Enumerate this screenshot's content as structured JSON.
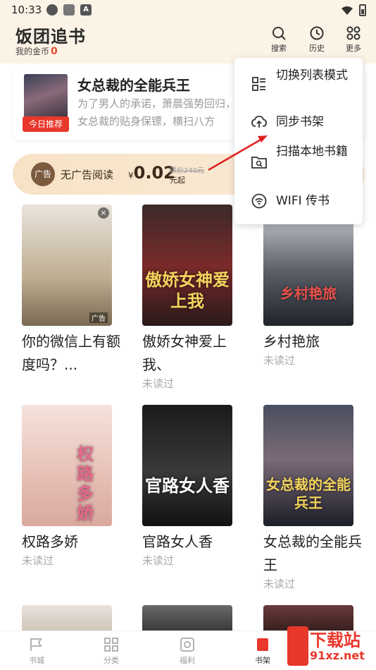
{
  "status_bar": {
    "time": "10:33"
  },
  "header": {
    "app_title": "饭团追书",
    "coins_label": "我的金币",
    "coins_value": "0",
    "actions": [
      {
        "label": "搜索",
        "icon": "search-icon"
      },
      {
        "label": "历史",
        "icon": "history-icon"
      },
      {
        "label": "更多",
        "icon": "more-icon"
      }
    ]
  },
  "banner": {
    "title": "女总裁的全能兵王",
    "description": "为了男人的承诺，萧晨强势回归，成为女总裁的贴身保镖，横扫八方",
    "tag": "今日推荐"
  },
  "ad_bar": {
    "icon_text": "广告",
    "label": "无广告阅读",
    "currency": "¥",
    "price": "0.02",
    "original_price": "原价240元",
    "unit": "元起"
  },
  "menu": {
    "items": [
      {
        "label": "切换列表模式",
        "icon": "list-mode-icon"
      },
      {
        "label": "同步书架",
        "icon": "cloud-sync-icon"
      },
      {
        "label": "扫描本地书籍",
        "icon": "scan-folder-icon"
      },
      {
        "label": "WIFI 传书",
        "icon": "wifi-icon"
      }
    ]
  },
  "books": [
    {
      "title": "你的微信上有额度吗？...",
      "status": "",
      "cover_text": "",
      "ad": "广告"
    },
    {
      "title": "傲娇女神爱上我、",
      "status": "未读过",
      "cover_text": "傲娇女神爱上我"
    },
    {
      "title": "乡村艳旅",
      "status": "未读过",
      "cover_text": "乡村艳旅"
    },
    {
      "title": "权路多娇",
      "status": "未读过",
      "cover_text": "权路多娇"
    },
    {
      "title": "官路女人香",
      "status": "未读过",
      "cover_text": "官路女人香"
    },
    {
      "title": "女总裁的全能兵王",
      "status": "未读过",
      "cover_text": "女总裁的全能兵王"
    }
  ],
  "tabbar": {
    "tabs": [
      {
        "label": "书城",
        "icon": "bookstore-icon"
      },
      {
        "label": "分类",
        "icon": "category-icon"
      },
      {
        "label": "福利",
        "icon": "welfare-icon"
      },
      {
        "label": "书架",
        "icon": "bookshelf-icon"
      }
    ]
  },
  "watermark": {
    "text": "下载站",
    "url": "91xz.net"
  },
  "colors": {
    "accent": "#e8372b",
    "header_bg": "#fbf3e6",
    "coin_red": "#e54b2e"
  }
}
